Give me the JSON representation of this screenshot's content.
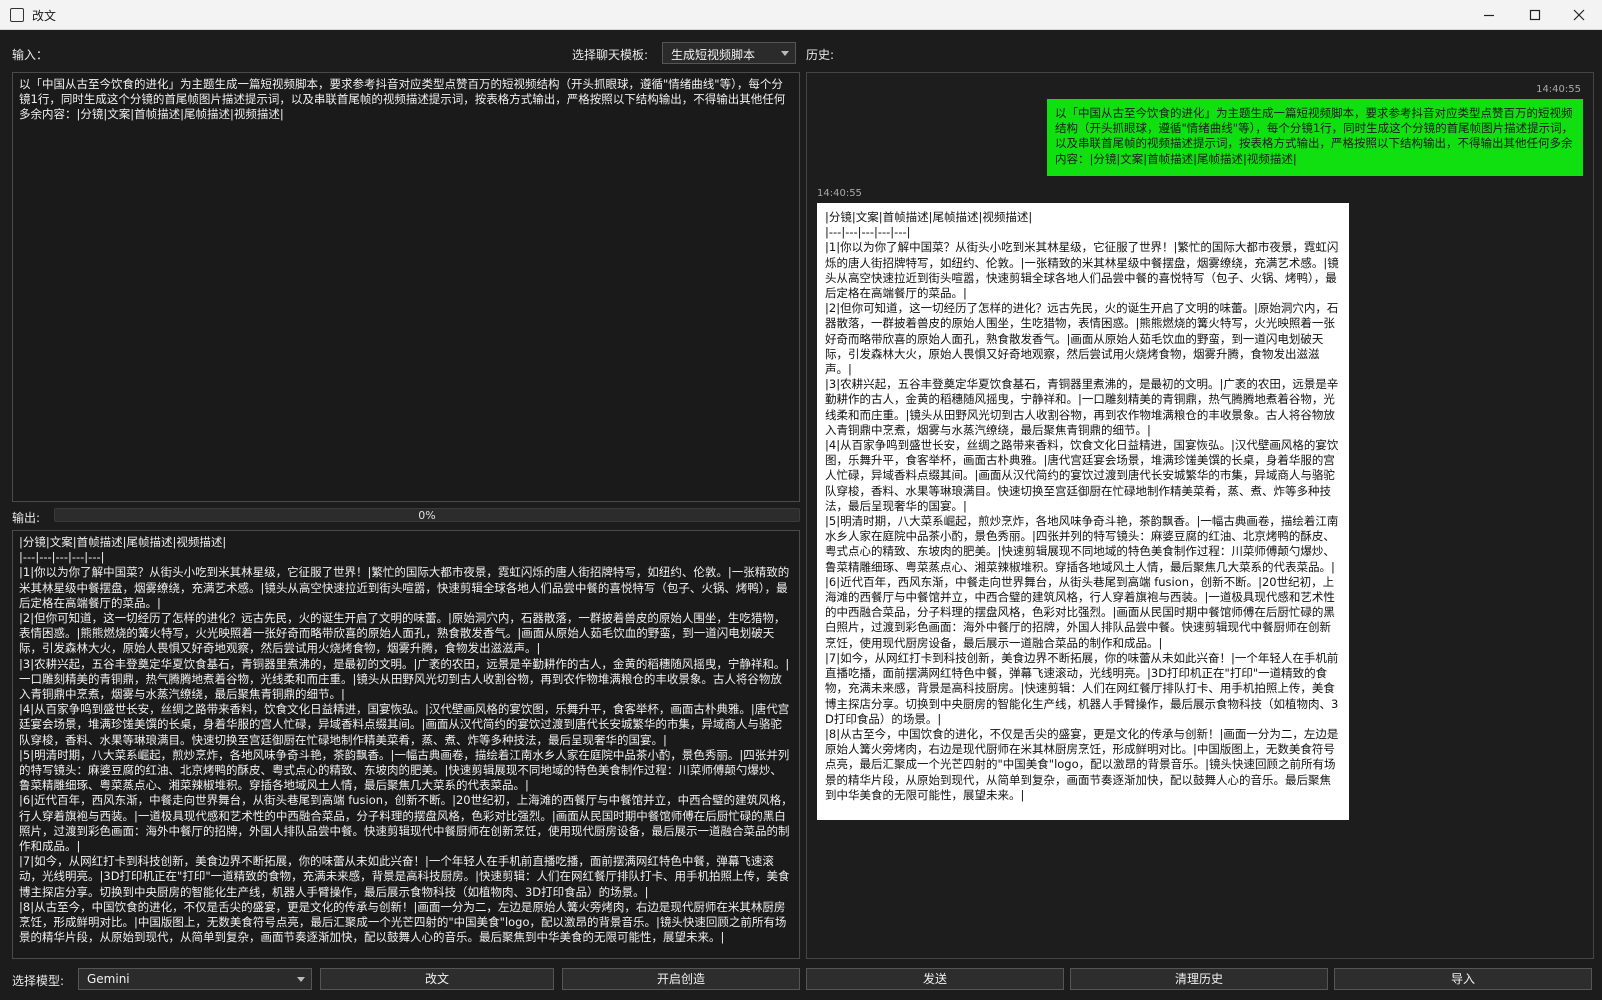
{
  "window": {
    "title": "改文"
  },
  "toolbar": {
    "input_label": "输入：",
    "template_label": "选择聊天模板:",
    "template_value": "生成短视频脚本",
    "history_label": "历史:",
    "output_label": "输出:",
    "progress_percent": 0,
    "progress_text": "0%"
  },
  "input_text": "以「中国从古至今饮食的进化」为主题生成一篇短视频脚本，要求参考抖音对应类型点赞百万的短视频结构（开头抓眼球，遵循\"情绪曲线\"等），每个分镜1行，同时生成这个分镜的首尾帧图片描述提示词，以及串联首尾帧的视频描述提示词，按表格方式输出，严格按照以下结构输出，不得输出其他任何多余内容：|分镜|文案|首帧描述|尾帧描述|视频描述|",
  "output_lines": [
    "|分镜|文案|首帧描述|尾帧描述|视频描述|",
    "|---|---|---|---|---|",
    "|1|你以为你了解中国菜？从街头小吃到米其林星级，它征服了世界！|繁忙的国际大都市夜景，霓虹闪烁的唐人街招牌特写，如纽约、伦敦。|一张精致的米其林星级中餐摆盘，烟雾缭绕，充满艺术感。|镜头从高空快速拉近到街头喧嚣，快速剪辑全球各地人们品尝中餐的喜悦特写（包子、火锅、烤鸭），最后定格在高端餐厅的菜品。|",
    "|2|但你可知道，这一切经历了怎样的进化？远古先民，火的诞生开启了文明的味蕾。|原始洞穴内，石器散落，一群披着兽皮的原始人围坐，生吃猎物，表情困惑。|熊熊燃烧的篝火特写，火光映照着一张好奇而略带欣喜的原始人面孔，熟食散发香气。|画面从原始人茹毛饮血的野蛮，到一道闪电划破天际，引发森林大火，原始人畏惧又好奇地观察，然后尝试用火烧烤食物，烟雾升腾，食物发出滋滋声。|",
    "|3|农耕兴起，五谷丰登奠定华夏饮食基石，青铜器里煮沸的，是最初的文明。|广袤的农田，远景是辛勤耕作的古人，金黄的稻穗随风摇曳，宁静祥和。|一口雕刻精美的青铜鼎，热气腾腾地煮着谷物，光线柔和而庄重。|镜头从田野风光切到古人收割谷物，再到农作物堆满粮仓的丰收景象。古人将谷物放入青铜鼎中烹煮，烟雾与水蒸汽缭绕，最后聚焦青铜鼎的细节。|",
    "|4|从百家争鸣到盛世长安，丝绸之路带来香料，饮食文化日益精进，国宴恢弘。|汉代壁画风格的宴饮图，乐舞升平，食客举杯，画面古朴典雅。|唐代宫廷宴会场景，堆满珍馐美馔的长桌，身着华服的宫人忙碌，异域香料点缀其间。|画面从汉代简约的宴饮过渡到唐代长安城繁华的市集，异域商人与骆驼队穿梭，香料、水果等琳琅满目。快速切换至宫廷御厨在忙碌地制作精美菜肴，蒸、煮、炸等多种技法，最后呈现奢华的国宴。|",
    "|5|明清时期，八大菜系崛起，煎炒烹炸，各地风味争奇斗艳，茶韵飘香。|一幅古典画卷，描绘着江南水乡人家在庭院中品茶小酌，景色秀丽。|四张并列的特写镜头：麻婆豆腐的红油、北京烤鸭的酥皮、粤式点心的精致、东坡肉的肥美。|快速剪辑展现不同地域的特色美食制作过程：川菜师傅颠勺爆炒、鲁菜精雕细琢、粤菜蒸点心、湘菜辣椒堆积。穿插各地域风土人情，最后聚焦几大菜系的代表菜品。|",
    "|6|近代百年，西风东渐，中餐走向世界舞台，从街头巷尾到高端 fusion，创新不断。|20世纪初，上海滩的西餐厅与中餐馆并立，中西合璧的建筑风格，行人穿着旗袍与西装。|一道极具现代感和艺术性的中西融合菜品，分子料理的摆盘风格，色彩对比强烈。|画面从民国时期中餐馆师傅在后厨忙碌的黑白照片，过渡到彩色画面：海外中餐厅的招牌，外国人排队品尝中餐。快速剪辑现代中餐厨师在创新烹饪，使用现代厨房设备，最后展示一道融合菜品的制作和成品。|",
    "|7|如今，从网红打卡到科技创新，美食边界不断拓展，你的味蕾从未如此兴奋！|一个年轻人在手机前直播吃播，面前摆满网红特色中餐，弹幕飞速滚动，光线明亮。|3D打印机正在\"打印\"一道精致的食物，充满未来感，背景是高科技厨房。|快速剪辑：人们在网红餐厅排队打卡、用手机拍照上传，美食博主探店分享。切换到中央厨房的智能化生产线，机器人手臂操作，最后展示食物科技（如植物肉、3D打印食品）的场景。|",
    "|8|从古至今，中国饮食的进化，不仅是舌尖的盛宴，更是文化的传承与创新！|画面一分为二，左边是原始人篝火旁烤肉，右边是现代厨师在米其林厨房烹饪，形成鲜明对比。|中国版图上，无数美食符号点亮，最后汇聚成一个光芒四射的\"中国美食\"logo，配以激昂的背景音乐。|镜头快速回顾之前所有场景的精华片段，从原始到现代，从简单到复杂，画面节奏逐渐加快，配以鼓舞人心的音乐。最后聚焦到中华美食的无限可能性，展望未来。|"
  ],
  "history": {
    "user_time": "14:40:55",
    "reply_time": "14:40:55"
  },
  "bottom": {
    "model_label": "选择模型:",
    "model_value": "Gemini",
    "rewrite_button": "改文",
    "create_button": "开启创造",
    "send_button": "发送",
    "clear_button": "清理历史",
    "import_button": "导入"
  }
}
